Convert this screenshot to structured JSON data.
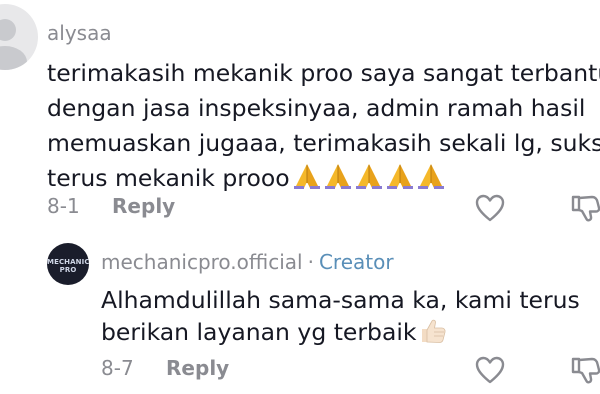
{
  "comment": {
    "username": "alysaa",
    "text_lines": [
      "terimakasih mekanik proo saya sangat terbantu",
      "dengan jasa inspeksinyaa, admin ramah hasil",
      "memuaskan jugaaa, terimakasih sekali lg, sukses",
      "terus mekanik prooo"
    ],
    "emoji": [
      "folded-hands-emoji",
      "folded-hands-emoji",
      "folded-hands-emoji",
      "folded-hands-emoji",
      "folded-hands-emoji"
    ],
    "date": "8-1",
    "reply_label": "Reply",
    "like_icon": "heart-icon",
    "dislike_icon": "thumbs-down-icon"
  },
  "reply": {
    "username": "mechanicpro.official",
    "separator": "·",
    "badge": "Creator",
    "avatar_logo": "MECHANIC PRO",
    "text_lines": [
      "Alhamdulillah sama-sama ka, kami terus",
      "berikan layanan yg terbaik"
    ],
    "emoji": "thumbs-up-emoji",
    "date": "8-7",
    "reply_label": "Reply",
    "like_icon": "heart-icon",
    "dislike_icon": "thumbs-down-icon"
  },
  "colors": {
    "text_primary": "#161823",
    "text_secondary": "#8a8b91",
    "creator_badge": "#5a8fb8",
    "emoji_yellow": "#f5b82a"
  }
}
